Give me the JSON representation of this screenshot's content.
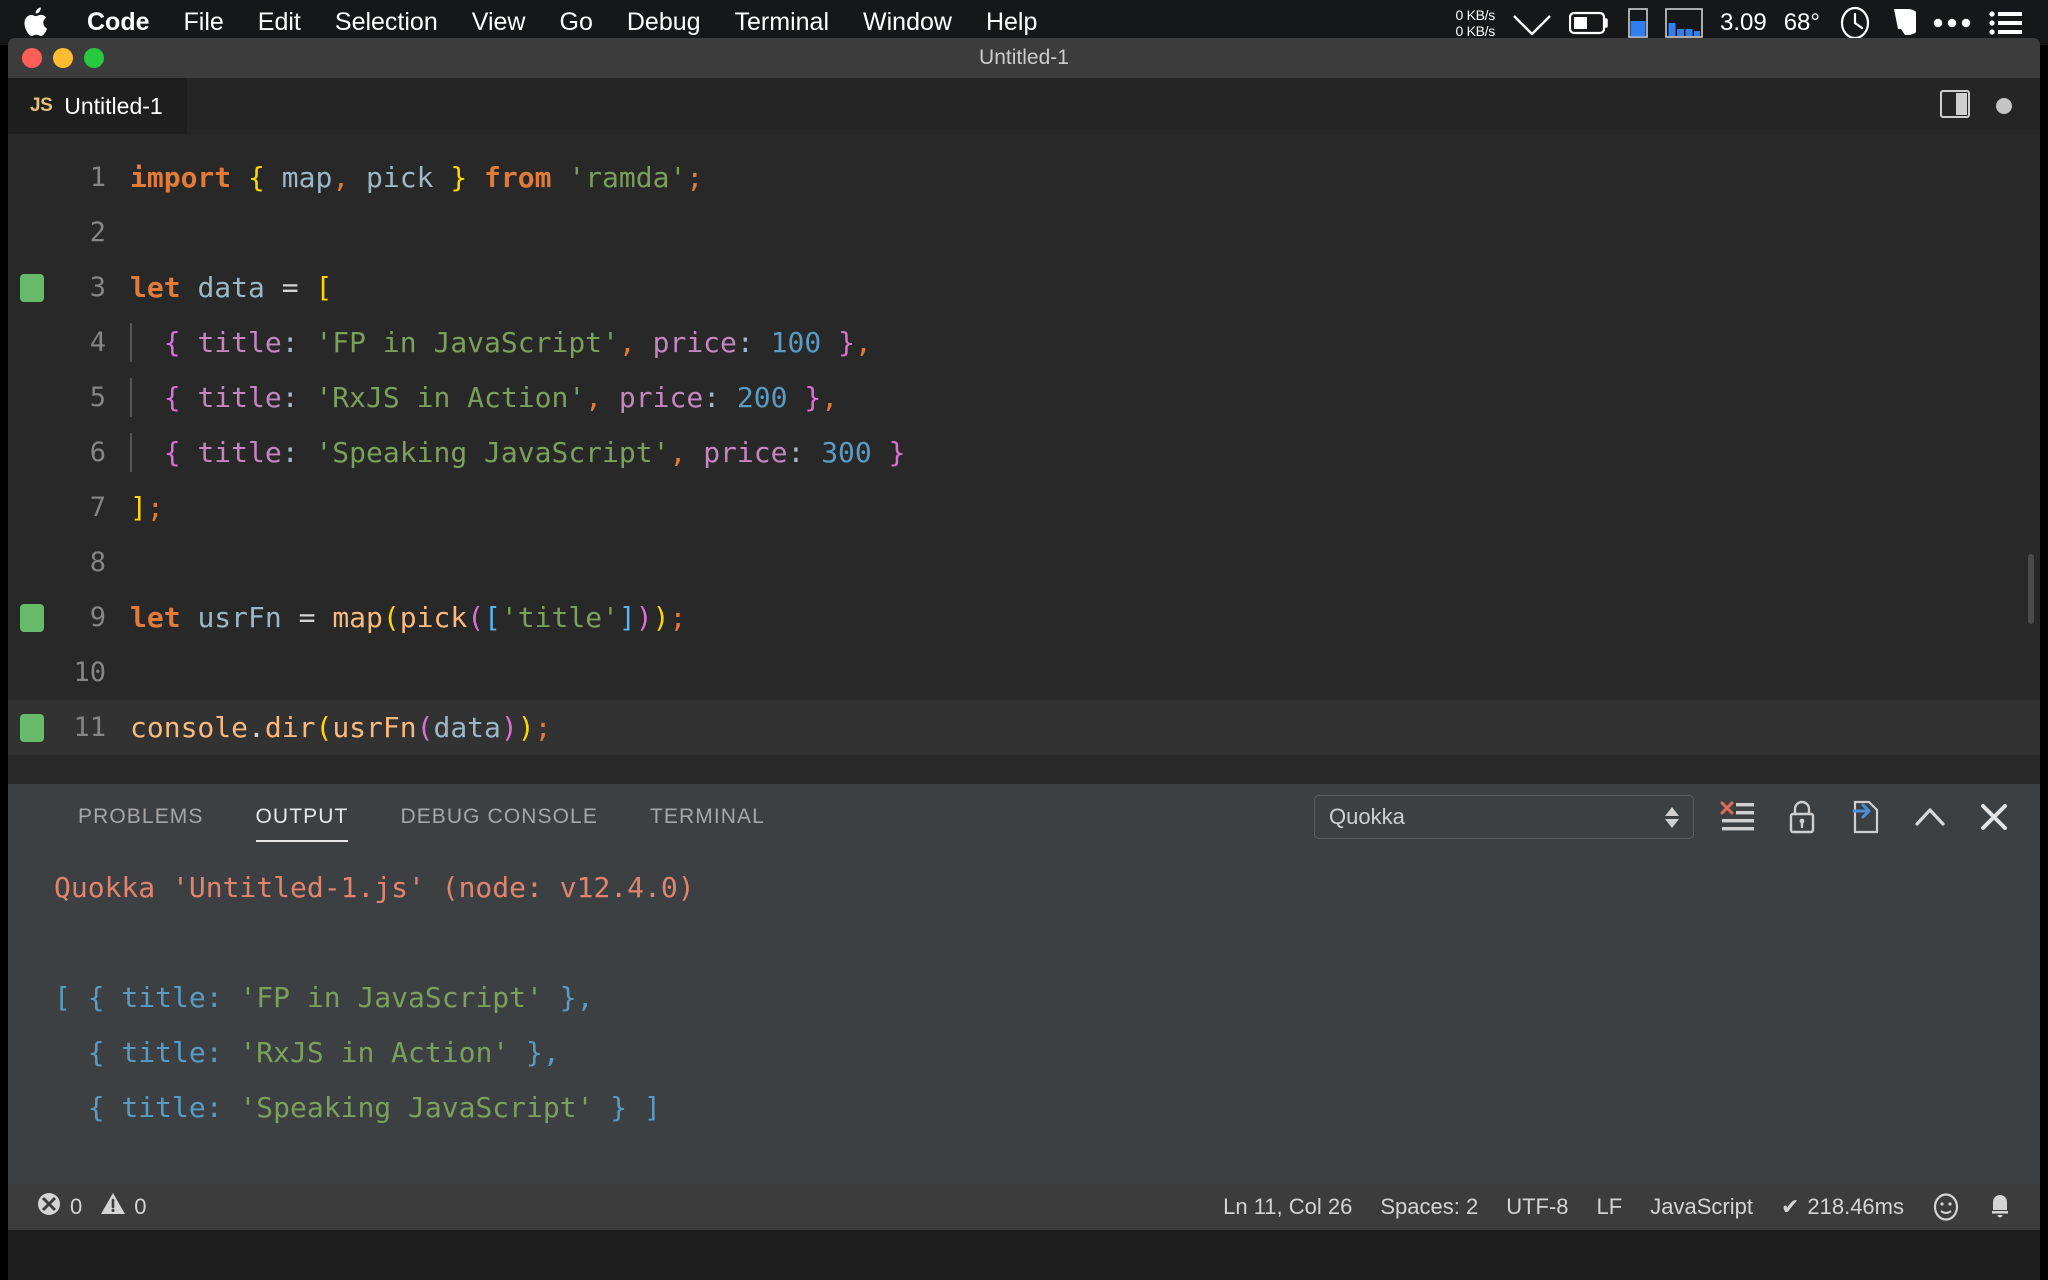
{
  "menubar": {
    "apple_icon": "apple-logo-icon",
    "items": [
      {
        "label": "Code",
        "bold": true
      },
      {
        "label": "File",
        "bold": false
      },
      {
        "label": "Edit",
        "bold": false
      },
      {
        "label": "Selection",
        "bold": false
      },
      {
        "label": "View",
        "bold": false
      },
      {
        "label": "Go",
        "bold": false
      },
      {
        "label": "Debug",
        "bold": false
      },
      {
        "label": "Terminal",
        "bold": false
      },
      {
        "label": "Window",
        "bold": false
      },
      {
        "label": "Help",
        "bold": false
      }
    ],
    "net_up": "0 KB/s",
    "net_down": "0 KB/s",
    "cpu_load": "3.09",
    "temperature": "68°",
    "icons": [
      "wifi-icon",
      "battery-icon",
      "memory-gauge-icon",
      "cpu-history-icon",
      "clock-icon",
      "bartender-icon",
      "ellipsis-icon",
      "control-center-icon"
    ]
  },
  "window": {
    "title": "Untitled-1",
    "traffic_lights": [
      "close-button",
      "minimize-button",
      "zoom-button"
    ]
  },
  "tabbar": {
    "tabs": [
      {
        "badge": "JS",
        "label": "Untitled-1",
        "active": true
      }
    ],
    "actions": [
      "split-editor-icon",
      "unsaved-dot-icon"
    ]
  },
  "editor": {
    "language": "JavaScript",
    "lines": [
      {
        "n": "1",
        "marker": false,
        "current": false
      },
      {
        "n": "2",
        "marker": false,
        "current": false
      },
      {
        "n": "3",
        "marker": true,
        "current": false
      },
      {
        "n": "4",
        "marker": false,
        "current": false
      },
      {
        "n": "5",
        "marker": false,
        "current": false
      },
      {
        "n": "6",
        "marker": false,
        "current": false
      },
      {
        "n": "7",
        "marker": false,
        "current": false
      },
      {
        "n": "8",
        "marker": false,
        "current": false
      },
      {
        "n": "9",
        "marker": true,
        "current": false
      },
      {
        "n": "10",
        "marker": false,
        "current": false
      },
      {
        "n": "11",
        "marker": true,
        "current": true
      }
    ],
    "code_text": [
      "import { map, pick } from 'ramda';",
      "",
      "let data = [",
      "  { title: 'FP in JavaScript', price: 100 },",
      "  { title: 'RxJS in Action', price: 200 },",
      "  { title: 'Speaking JavaScript', price: 300 }",
      "];",
      "",
      "let usrFn = map(pick(['title']));",
      "",
      "console.dir(usrFn(data));"
    ],
    "data_objects": [
      {
        "title": "FP in JavaScript",
        "price": "100"
      },
      {
        "title": "RxJS in Action",
        "price": "200"
      },
      {
        "title": "Speaking JavaScript",
        "price": "300"
      }
    ]
  },
  "panel": {
    "tabs": [
      {
        "label": "PROBLEMS",
        "active": false
      },
      {
        "label": "OUTPUT",
        "active": true
      },
      {
        "label": "DEBUG CONSOLE",
        "active": false
      },
      {
        "label": "TERMINAL",
        "active": false
      }
    ],
    "channel_selected": "Quokka",
    "actions": [
      "clear-output-icon",
      "lock-scroll-icon",
      "open-in-editor-icon",
      "maximize-panel-icon",
      "close-panel-icon"
    ],
    "output_lines": [
      "Quokka 'Untitled-1.js' (node: v12.4.0)",
      "",
      "[ { title: 'FP in JavaScript' },",
      "  { title: 'RxJS in Action' },",
      "  { title: 'Speaking JavaScript' } ]"
    ],
    "output_header": {
      "program": "Quokka",
      "file": "'Untitled-1.js'",
      "runtime": "(node: v12.4.0)"
    },
    "output_results": [
      "'FP in JavaScript'",
      "'RxJS in Action'",
      "'Speaking JavaScript'"
    ]
  },
  "statusbar": {
    "errors": "0",
    "warnings": "0",
    "cursor": "Ln 11, Col 26",
    "spaces": "Spaces: 2",
    "encoding": "UTF-8",
    "eol": "LF",
    "language": "JavaScript",
    "runtime": "218.46ms",
    "runtime_check": "✔",
    "icons": [
      "error-icon",
      "warning-icon",
      "feedback-smiley-icon",
      "notifications-bell-icon"
    ]
  },
  "colors": {
    "accent_keyword": "#e07b39",
    "accent_string": "#7ba05b",
    "accent_number": "#5a9bc4",
    "accent_property": "#c586c0",
    "accent_function": "#fcb97d",
    "marker_green": "#66bb6a",
    "output_salmon": "#e2846d",
    "editor_bg": "#282828",
    "panel_bg": "#3c4043"
  }
}
